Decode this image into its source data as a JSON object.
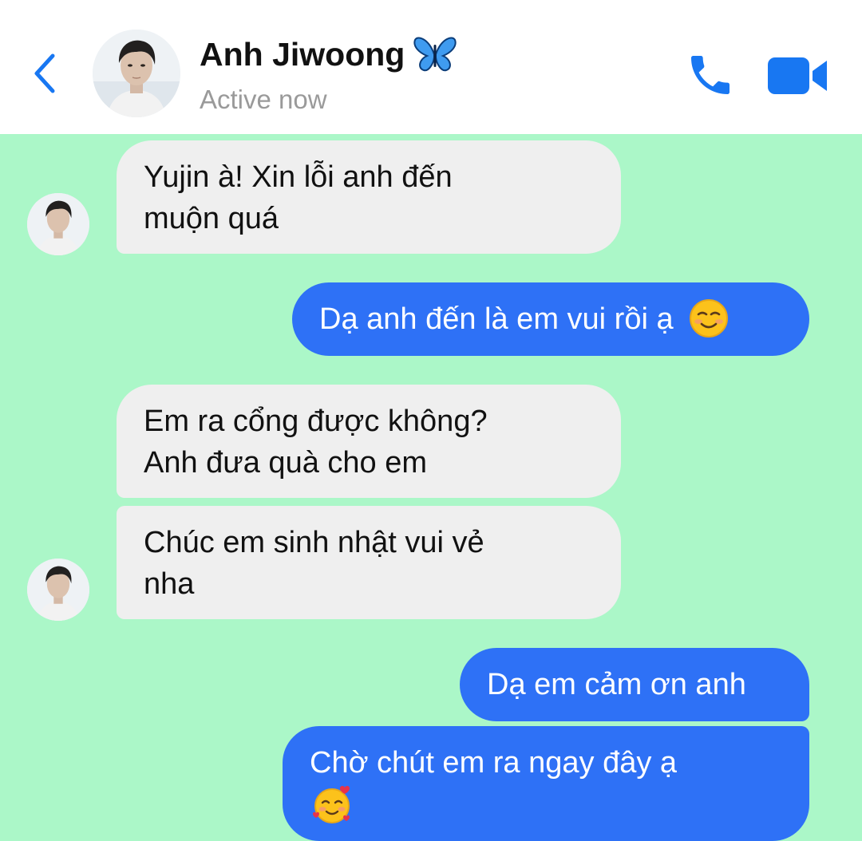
{
  "header": {
    "name": "Anh Jiwoong",
    "name_emoji": "butterfly-emoji",
    "status": "Active now",
    "icons": [
      "chevron-left-icon",
      "phone-icon",
      "video-camera-icon"
    ],
    "accent": "#1877f2"
  },
  "chat": {
    "background": "#abf7c8",
    "incoming_color": "#efefef",
    "outgoing_color": "#2e71f6",
    "messages": [
      {
        "from": "contact",
        "lines": [
          "Yujin à! Xin lỗi anh đến",
          "muộn quá"
        ]
      },
      {
        "from": "me",
        "lines": [
          "Dạ anh đến là em vui rồi ạ"
        ],
        "emoji": "smiling-face-emoji"
      },
      {
        "from": "contact",
        "lines": [
          "Em ra cổng được không?",
          "Anh đưa quà cho em"
        ]
      },
      {
        "from": "contact",
        "lines": [
          "Chúc em sinh nhật vui vẻ",
          "nha"
        ]
      },
      {
        "from": "me",
        "lines": [
          "Dạ em cảm ơn anh"
        ]
      },
      {
        "from": "me",
        "lines": [
          "Chờ chút em ra ngay đây ạ"
        ],
        "emoji": "smiling-face-with-hearts-emoji"
      }
    ]
  }
}
